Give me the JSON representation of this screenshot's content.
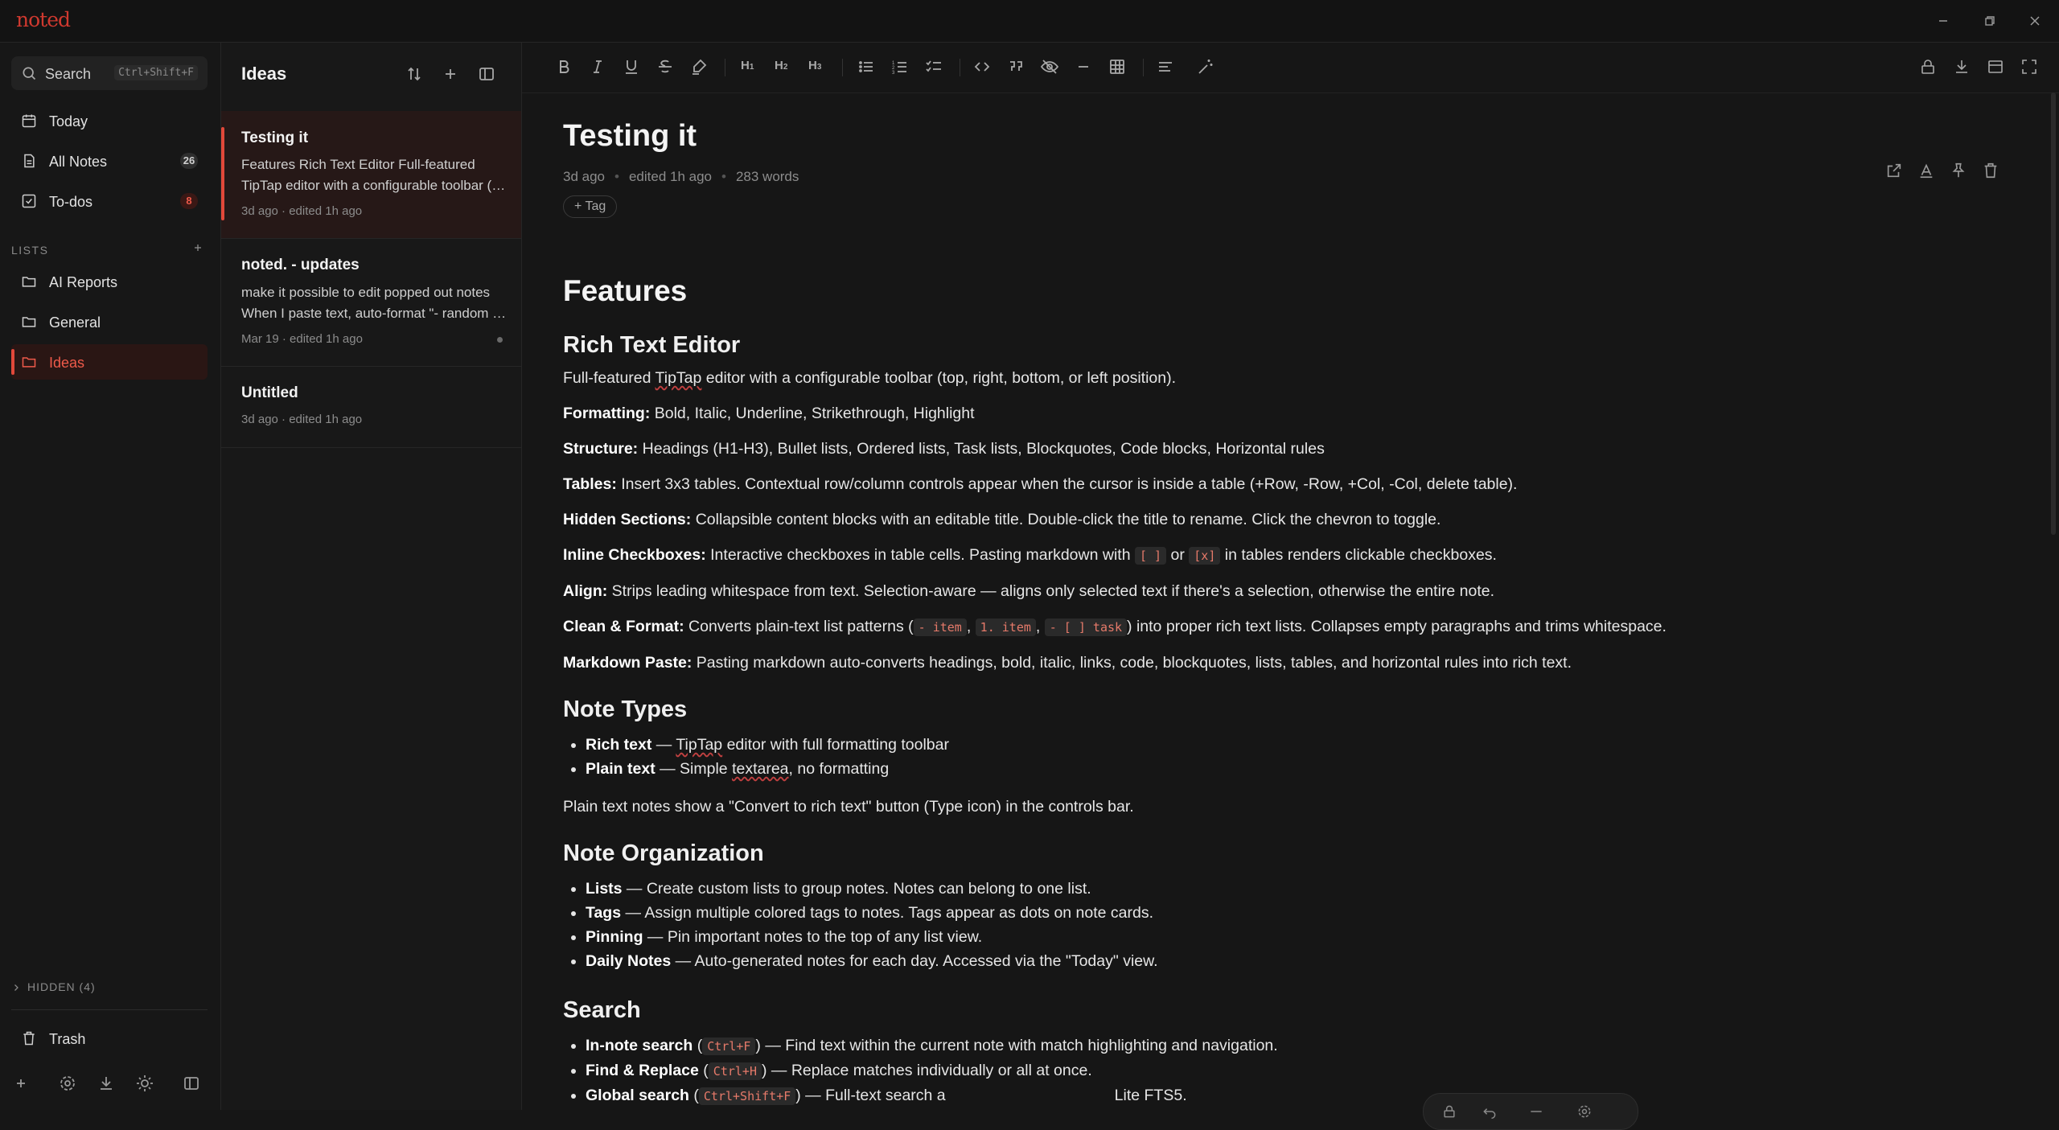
{
  "app": {
    "logo": "noted"
  },
  "sidebar": {
    "search": {
      "label": "Search",
      "shortcut": "Ctrl+Shift+F"
    },
    "nav": [
      {
        "label": "Today"
      },
      {
        "label": "All Notes",
        "count": "26"
      },
      {
        "label": "To-dos",
        "count": "8"
      }
    ],
    "lists_header": "LISTS",
    "lists": [
      {
        "label": "AI Reports"
      },
      {
        "label": "General"
      },
      {
        "label": "Ideas"
      }
    ],
    "hidden": "HIDDEN (4)",
    "trash": "Trash"
  },
  "noteslist": {
    "title": "Ideas",
    "notes": [
      {
        "title": "Testing it",
        "preview1": "Features Rich Text Editor Full-featured",
        "preview2": "TipTap editor with a configurable toolbar (top, right, bottom, or left position).",
        "meta": "3d ago · edited 1h ago"
      },
      {
        "title": "noted. - updates",
        "preview1": "make it possible to edit popped out notes",
        "preview2": "When I paste text, auto-format \"- random item\" into a list",
        "meta": "Mar 19 · edited 1h ago"
      },
      {
        "title": "Untitled",
        "meta": "3d ago · edited 1h ago"
      }
    ]
  },
  "editor": {
    "toolbar": {
      "h1": "H",
      "h1s": "1",
      "h2": "H",
      "h2s": "2",
      "h3": "H",
      "h3s": "3"
    },
    "title": "Testing it",
    "meta": {
      "created": "3d ago",
      "edited": "edited 1h ago",
      "words": "283 words"
    },
    "tag_label": "+ Tag",
    "content": {
      "h1": "Features",
      "rte": {
        "h": "Rich Text Editor",
        "p1_a": "Full-featured ",
        "p1_b": "TipTap",
        "p1_c": " editor with a configurable toolbar (top, right, bottom, or left position).",
        "fmt_k": "Formatting:",
        "fmt_v": " Bold, Italic, Underline, Strikethrough, Highlight",
        "str_k": "Structure:",
        "str_v": " Headings (H1-H3), Bullet lists, Ordered lists, Task lists, Blockquotes, Code blocks, Horizontal rules",
        "tab_k": "Tables:",
        "tab_v": " Insert 3x3 tables. Contextual row/column controls appear when the cursor is inside a table (+Row, -Row, +Col, -Col, delete table).",
        "hid_k": "Hidden Sections:",
        "hid_v": " Collapsible content blocks with an editable title. Double-click the title to rename. Click the chevron to toggle.",
        "chk_k": "Inline Checkboxes:",
        "chk_v1": " Interactive checkboxes in table cells. Pasting markdown with ",
        "chk_c1": "[ ]",
        "chk_v2": " or ",
        "chk_c2": "[x]",
        "chk_v3": " in tables renders clickable checkboxes.",
        "aln_k": "Align:",
        "aln_v": " Strips leading whitespace from text. Selection-aware — aligns only selected text if there's a selection, otherwise the entire note.",
        "cln_k": "Clean & Format:",
        "cln_v1": " Converts plain-text list patterns (",
        "cln_c1": "- item",
        "cln_s1": ", ",
        "cln_c2": "1. item",
        "cln_s2": ", ",
        "cln_c3": "- [ ] task",
        "cln_v2": ") into proper rich text lists. Collapses empty paragraphs and trims whitespace.",
        "md_k": "Markdown Paste:",
        "md_v": " Pasting markdown auto-converts headings, bold, italic, links, code, blockquotes, lists, tables, and horizontal rules into rich text."
      },
      "types": {
        "h": "Note Types",
        "i1_k": "Rich text",
        "i1_v1": " — ",
        "i1_v2": "TipTap",
        "i1_v3": " editor with full formatting toolbar",
        "i2_k": "Plain text",
        "i2_v1": " — Simple ",
        "i2_v2": "textarea",
        "i2_v3": ", no formatting",
        "p": "Plain text notes show a \"Convert to rich text\" button (Type icon) in the controls bar."
      },
      "org": {
        "h": "Note Organization",
        "i1_k": "Lists",
        "i1_v": " — Create custom lists to group notes. Notes can belong to one list.",
        "i2_k": "Tags",
        "i2_v": " — Assign multiple colored tags to notes. Tags appear as dots on note cards.",
        "i3_k": "Pinning",
        "i3_v": " — Pin important notes to the top of any list view.",
        "i4_k": "Daily Notes",
        "i4_v": " — Auto-generated notes for each day. Accessed via the \"Today\" view."
      },
      "search": {
        "h": "Search",
        "i1_k": "In-note search",
        "i1_a": " (",
        "i1_c": "Ctrl+F",
        "i1_b": ") — Find text within the current note with match highlighting and navigation.",
        "i2_k": "Find & Replace",
        "i2_a": " (",
        "i2_c": "Ctrl+H",
        "i2_b": ") — Replace matches individually or all at once.",
        "i3_k": "Global search",
        "i3_a": " (",
        "i3_c": "Ctrl+Shift+F",
        "i3_b": ") — Full-text search a",
        "i3_d": "Lite FTS5."
      }
    }
  },
  "colors": {
    "accent": "#e2483a",
    "background": "#161616",
    "sidebar": "#171717"
  }
}
